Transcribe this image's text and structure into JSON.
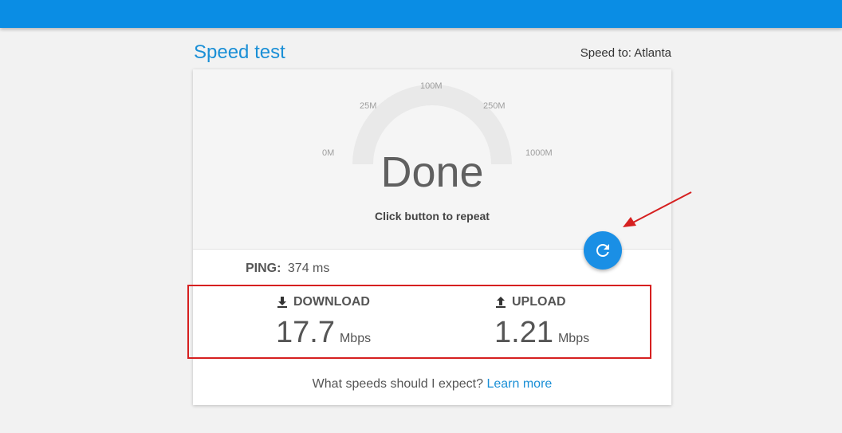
{
  "page": {
    "title": "Speed test",
    "speed_to": "Speed to: Atlanta"
  },
  "gauge": {
    "ticks": [
      "0M",
      "25M",
      "100M",
      "250M",
      "1000M"
    ],
    "status": "Done",
    "hint": "Click button to repeat"
  },
  "results": {
    "ping_label": "PING:",
    "ping_value": "374 ms",
    "download_label": "DOWNLOAD",
    "download_value": "17.7",
    "download_unit": "Mbps",
    "upload_label": "UPLOAD",
    "upload_value": "1.21",
    "upload_unit": "Mbps"
  },
  "footer": {
    "question": "What speeds should I expect?",
    "link": "Learn more"
  },
  "icons": {
    "repeat": "refresh-icon",
    "download": "download-arrow-icon",
    "upload": "upload-arrow-icon"
  },
  "colors": {
    "topbar": "#0a8de4",
    "accent": "#1a8fd6",
    "annotation": "#d62020"
  }
}
